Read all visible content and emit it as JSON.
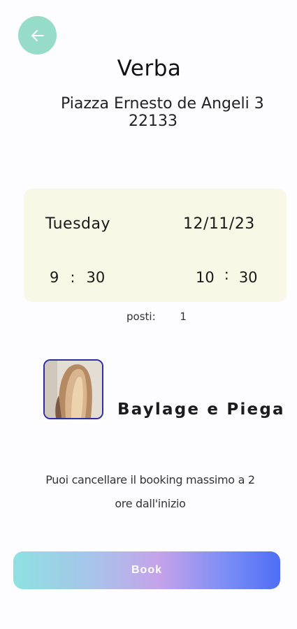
{
  "header": {
    "back_icon": "arrow-left-icon",
    "accent_color": "#96dcc9"
  },
  "venue": {
    "name": "Verba",
    "street": "Piazza Ernesto de Angeli 3",
    "zip": "22133"
  },
  "booking": {
    "day": "Tuesday",
    "date": "12/11/23",
    "start_hour": "9",
    "start_minute": "30",
    "end_hour": "10",
    "end_minute": "30",
    "time_separator": ":",
    "seats_label": "posti:",
    "seats_value": "1",
    "card_color": "#f8f8e6"
  },
  "service": {
    "name": "Baylage e Piega",
    "image": "hair-photo"
  },
  "note": {
    "line1": "Puoi cancellare il booking massimo a 2",
    "line2": "ore dall'inizio"
  },
  "actions": {
    "book_label": "Book"
  }
}
